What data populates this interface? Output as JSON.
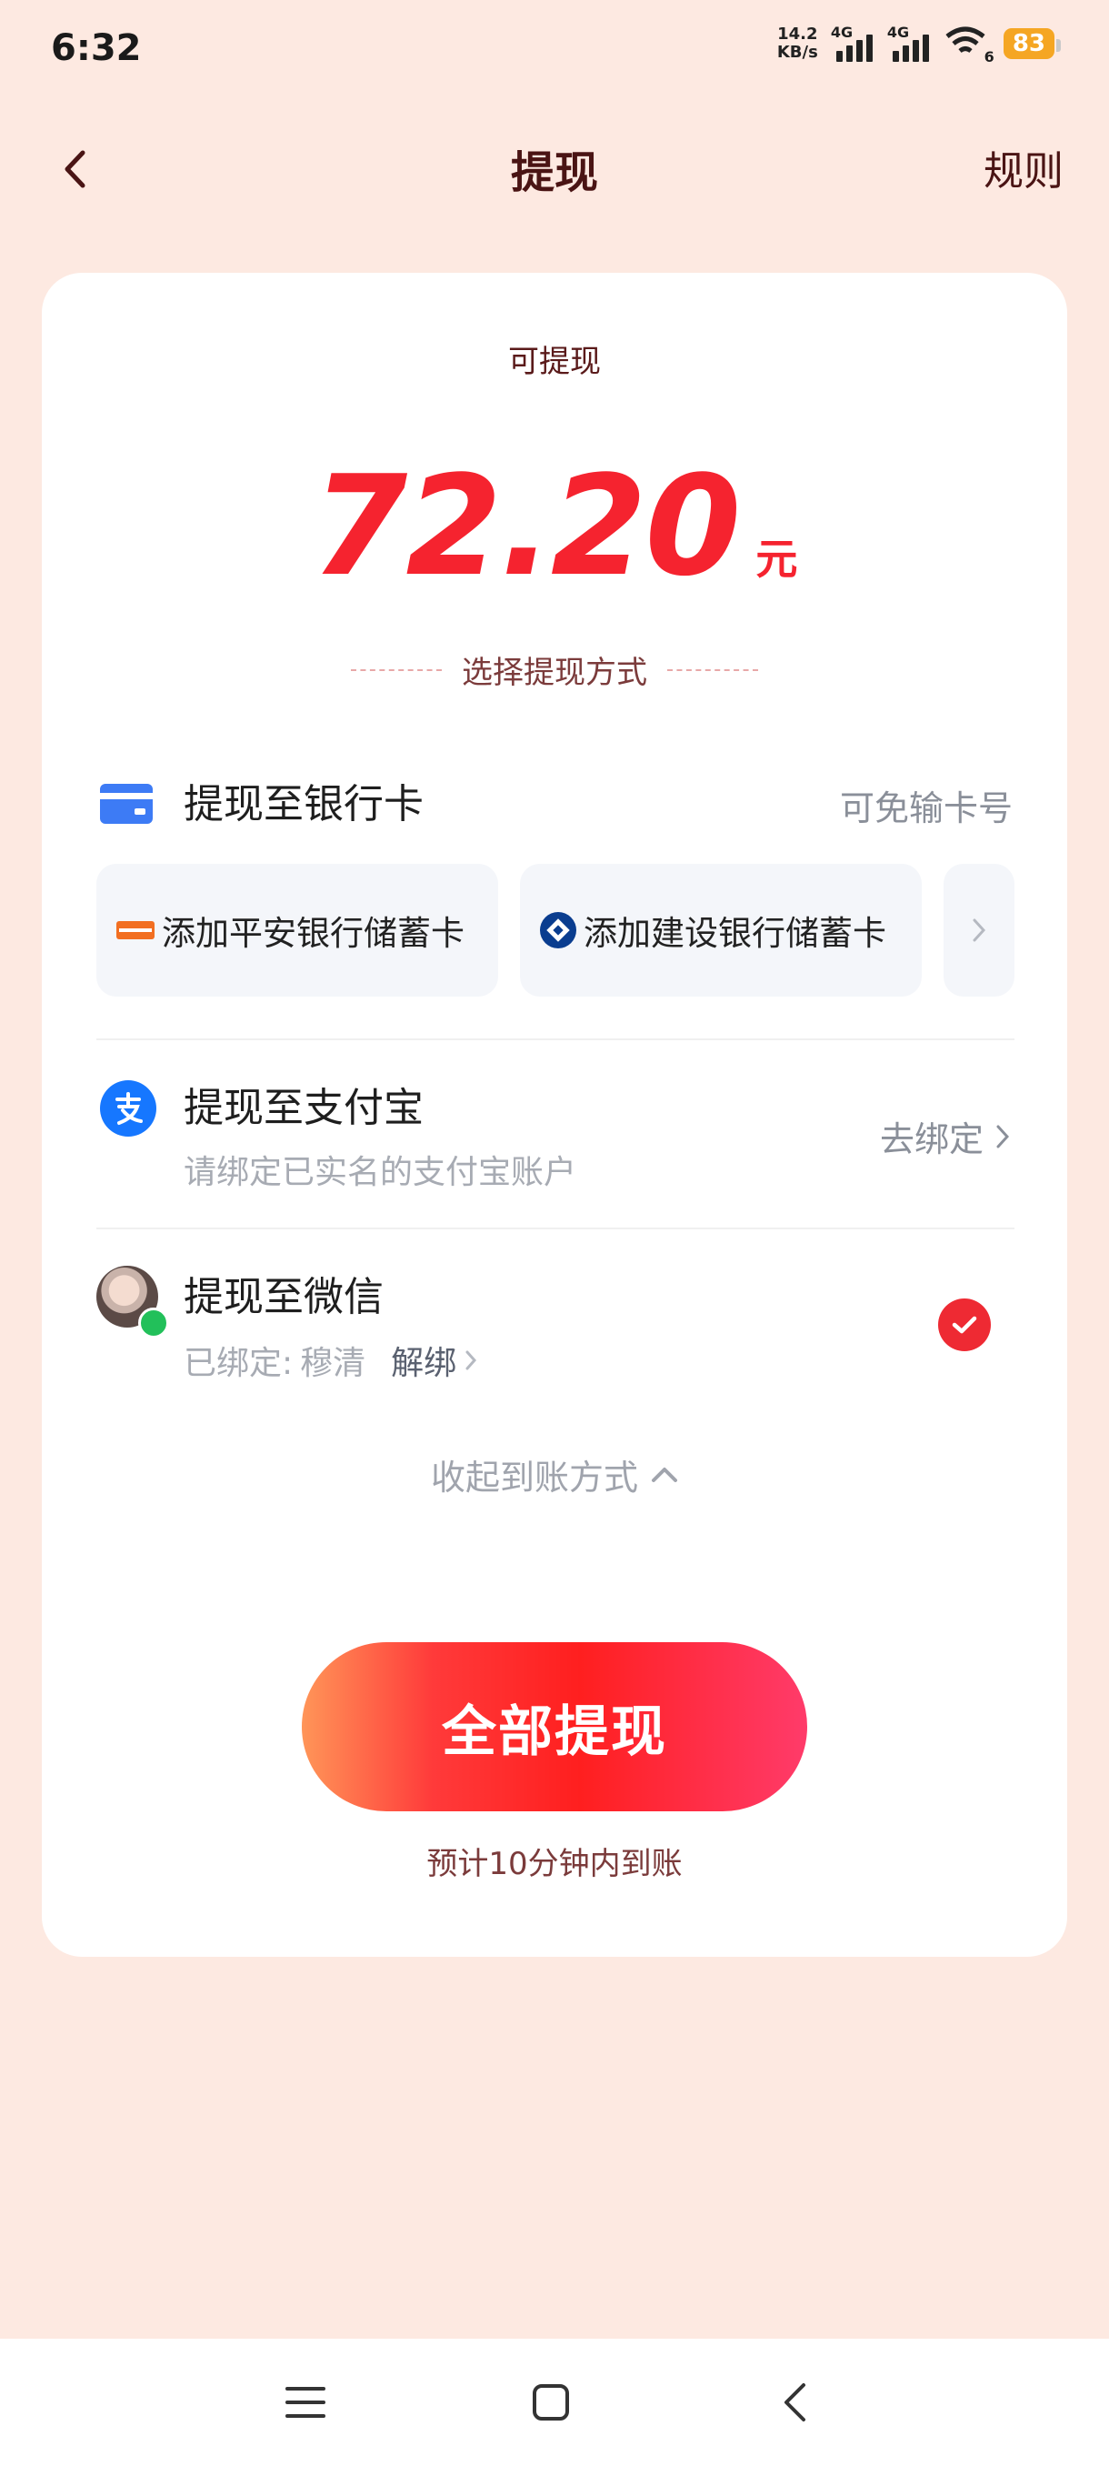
{
  "status_bar": {
    "time": "6:32",
    "net_speed_value": "14.2",
    "net_speed_unit": "KB/s",
    "sim1": "4G",
    "sim2": "4G",
    "wifi_tag": "6",
    "battery": "83"
  },
  "header": {
    "title": "提现",
    "rules_label": "规则"
  },
  "balance": {
    "label": "可提现",
    "amount": "72.20",
    "unit": "元"
  },
  "method_section_label": "选择提现方式",
  "bank": {
    "title": "提现至银行卡",
    "hint": "可免输卡号",
    "options": [
      {
        "label": "添加平安银行储蓄卡"
      },
      {
        "label": "添加建设银行储蓄卡"
      }
    ]
  },
  "alipay": {
    "title": "提现至支付宝",
    "subtitle": "请绑定已实名的支付宝账户",
    "bind_label": "去绑定"
  },
  "wechat": {
    "title": "提现至微信",
    "bound_prefix": "已绑定:",
    "account_name": "穆清",
    "unbind_label": "解绑",
    "selected": true
  },
  "collapse_label": "收起到账方式",
  "cta": {
    "label": "全部提现",
    "eta": "预计10分钟内到账"
  },
  "colors": {
    "accent": "#f5232f",
    "background": "#fde9e1",
    "check": "#ee2a33",
    "alipay": "#1677ff",
    "wechat": "#22c05a"
  }
}
